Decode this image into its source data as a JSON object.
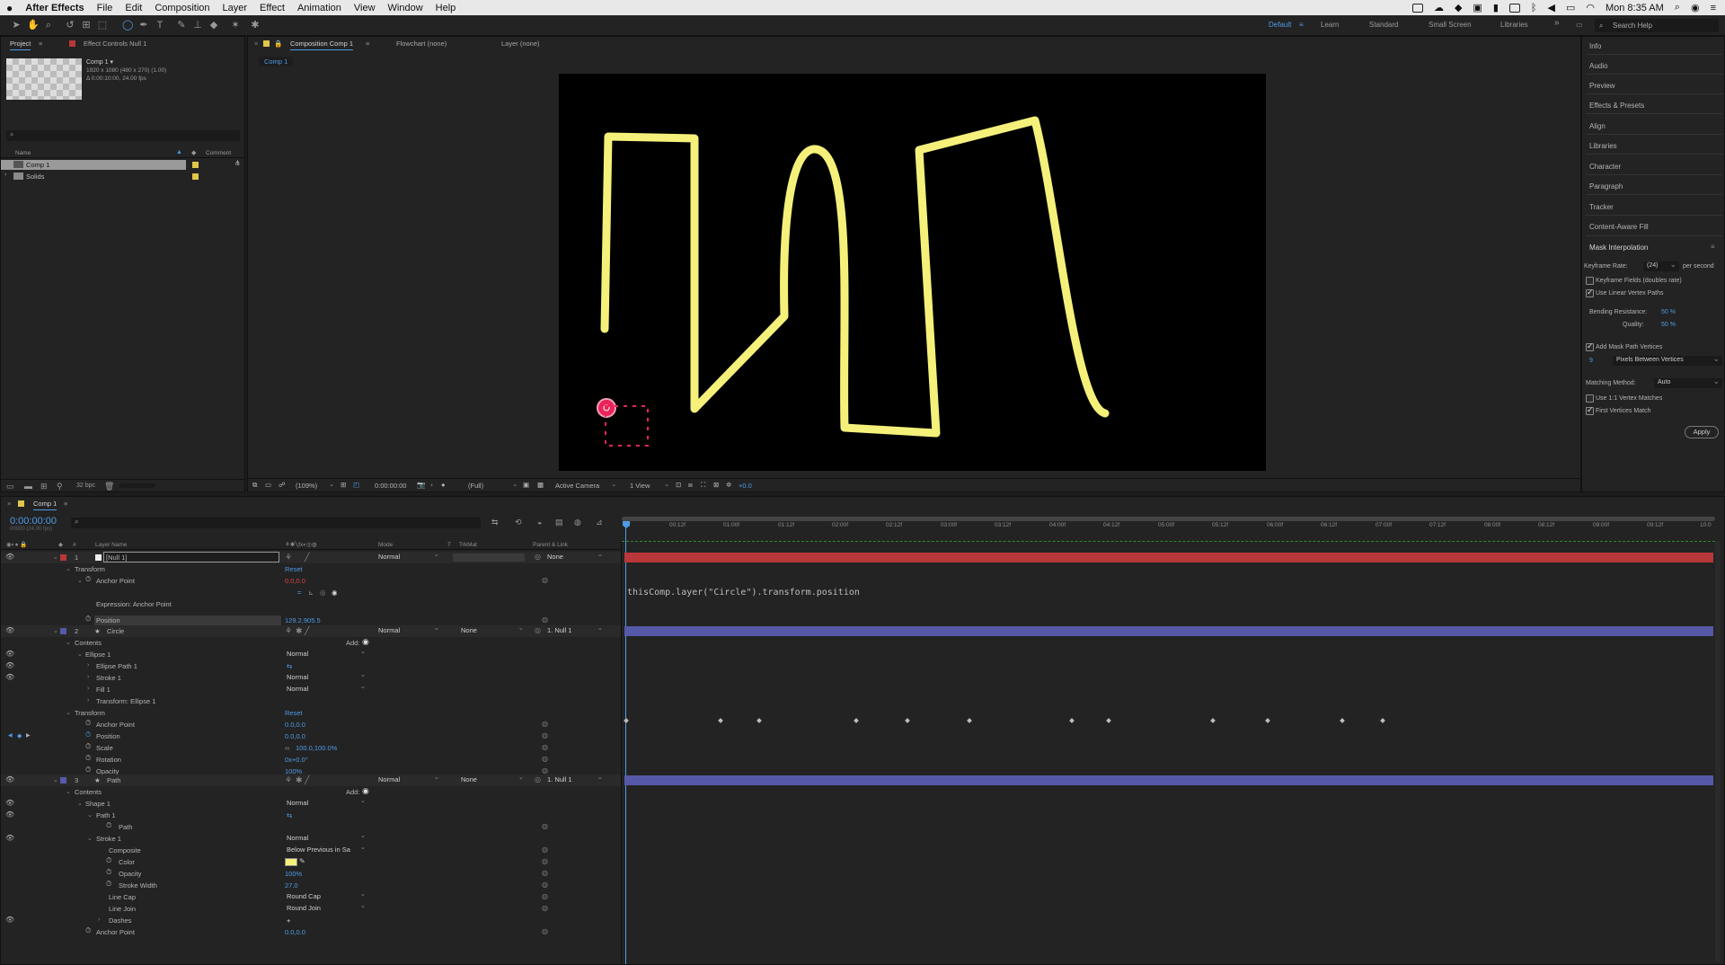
{
  "menubar": {
    "apple": "",
    "items": [
      "After Effects",
      "File",
      "Edit",
      "Composition",
      "Layer",
      "Effect",
      "Animation",
      "View",
      "Window",
      "Help"
    ],
    "clock": "Mon 8:35 AM"
  },
  "toolbar": {
    "workspaces": [
      "Default",
      "Learn",
      "Standard",
      "Small Screen",
      "Libraries"
    ],
    "search_placeholder": "Search Help"
  },
  "project_panel": {
    "tab_project": "Project",
    "tab_effect_controls": "Effect Controls Null 1",
    "comp_name": "Comp 1 ▾",
    "comp_info_1": "1920 x 1080  (480 x 270) (1.00)",
    "comp_info_2": "Δ 0:00:10:00, 24.00 fps",
    "col_name": "Name",
    "col_comment": "Comment",
    "items": [
      "Comp 1",
      "Solids"
    ],
    "bpc": "32 bpc"
  },
  "viewer": {
    "tab_comp": "Composition Comp 1",
    "tab_flowchart": "Flowchart (none)",
    "tab_layer": "Layer (none)",
    "breadcrumb": "Comp 1",
    "zoom": "(109%)",
    "timecode": "0:00:00:00",
    "resolution": "(Full)",
    "camera": "Active Camera",
    "views": "1 View",
    "exposure": "+0.0"
  },
  "right_panel": {
    "items": [
      "Info",
      "Audio",
      "Preview",
      "Effects & Presets",
      "Align",
      "Libraries",
      "Character",
      "Paragraph",
      "Tracker",
      "Content-Aware Fill"
    ],
    "mask_title": "Mask Interpolation",
    "keyframe_rate_label": "Keyframe Rate:",
    "keyframe_rate_value": "(24)",
    "per_second": "per second",
    "keyframe_fields": "Keyframe Fields (doubles rate)",
    "linear_vertex": "Use Linear Vertex Paths",
    "bending_label": "Bending Resistance:",
    "bending_value": "50 %",
    "quality_label": "Quality:",
    "quality_value": "50 %",
    "add_vertices": "Add Mask Path Vertices",
    "vertices_value": "9",
    "vertices_mode": "Pixels Between Vertices",
    "matching_label": "Matching Method:",
    "matching_value": "Auto",
    "use_1_1": "Use 1:1 Vertex Matches",
    "first_vertices": "First Vertices Match",
    "apply": "Apply"
  },
  "timeline": {
    "tab": "Comp 1",
    "timecode": "0:00:00:00",
    "fps_sub": "00000 (24.00 fps)",
    "col_layer_name": "Layer Name",
    "col_mode": "Mode",
    "col_t": "T",
    "col_trkmat": "TrkMat",
    "col_parent": "Parent & Link",
    "ruler": [
      "0f",
      "00:12f",
      "01:00f",
      "01:12f",
      "02:00f",
      "02:12f",
      "03:00f",
      "03:12f",
      "04:00f",
      "04:12f",
      "05:00f",
      "05:12f",
      "06:00f",
      "06:12f",
      "07:00f",
      "07:12f",
      "08:00f",
      "08:12f",
      "09:00f",
      "09:12f",
      "10:0"
    ],
    "expression_text": "thisComp.layer(\"Circle\").transform.position",
    "rows": {
      "l1_num": "1",
      "l1_name": "[Null 1]",
      "l1_mode": "Normal",
      "l1_parent": "None",
      "transform": "Transform",
      "reset": "Reset",
      "anchor_point": "Anchor Point",
      "l1_anchor_val": "0.0,0.0",
      "expr_label": "Expression: Anchor Point",
      "position": "Position",
      "l1_position_val": "129.2,905.5",
      "l2_num": "2",
      "l2_name": "Circle",
      "l2_mode": "Normal",
      "l2_trkmat": "None",
      "l2_parent": "1. Null 1",
      "contents": "Contents",
      "add": "Add:",
      "ellipse1": "Ellipse 1",
      "ellipse_path": "Ellipse Path 1",
      "stroke1": "Stroke 1",
      "fill1": "Fill 1",
      "transform_ellipse": "Transform: Ellipse 1",
      "normal": "Normal",
      "l2_anchor_val": "0.0,0.0",
      "l2_position_val": "0.0,0.0",
      "scale": "Scale",
      "scale_val": "100.0,100.0%",
      "rotation": "Rotation",
      "rotation_val": "0x+0.0°",
      "opacity": "Opacity",
      "opacity_val": "100%",
      "l3_num": "3",
      "l3_name": "Path",
      "l3_mode": "Normal",
      "l3_trkmat": "None",
      "l3_parent": "1. Null 1",
      "shape1": "Shape 1",
      "path1": "Path 1",
      "path": "Path",
      "composite": "Composite",
      "composite_val": "Below Previous in Sa",
      "color": "Color",
      "stroke_opacity_val": "100%",
      "stroke_width": "Stroke Width",
      "stroke_width_val": "27.0",
      "line_cap": "Line Cap",
      "line_cap_val": "Round Cap",
      "line_join": "Line Join",
      "line_join_val": "Round Join",
      "dashes": "Dashes",
      "dashes_val": "+",
      "l3_anchor_val": "0.0,0.0"
    }
  },
  "colors": {
    "accent": "#4d9be6",
    "null_bar": "#b8373a",
    "shape_bar": "#5559a8",
    "stroke_yellow": "#f4f07a",
    "circle_red": "#e8245a"
  }
}
